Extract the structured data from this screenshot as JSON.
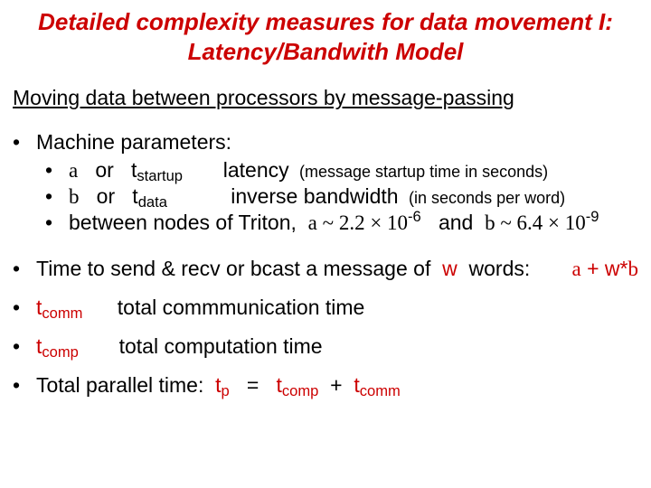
{
  "title_line1": "Detailed complexity measures for data movement I:",
  "title_line2": "Latency/Bandwith Model",
  "subheading": "Moving data between processors by message-passing",
  "params_label": "Machine parameters:",
  "alpha_line": {
    "sym": "a",
    "or": "or",
    "tvar": "t",
    "tsub": "startup",
    "label": "latency",
    "paren": "(message startup time in seconds)"
  },
  "beta_line": {
    "sym": "b",
    "or": "or",
    "tvar": "t",
    "tsub": "data",
    "label": "inverse bandwidth",
    "paren": "(in seconds per word)"
  },
  "triton": {
    "prefix": "between nodes of Triton,",
    "alpha_part": "a ~ 2.2 × 10",
    "alpha_exp": "-6",
    "and": "and",
    "beta_part": "b ~ 6.4 × 10",
    "beta_exp": "-9"
  },
  "send_recv": {
    "text": "Time to send & recv or bcast a message of",
    "w": "w",
    "words": "words:",
    "formula_a": "a",
    "formula_plus": " + w*",
    "formula_b": "b"
  },
  "tcomm": {
    "var": "t",
    "sub": "comm",
    "desc": "total commmunication time"
  },
  "tcomp": {
    "var": "t",
    "sub": "comp",
    "desc": "total computation time"
  },
  "total": {
    "label": "Total parallel time:",
    "tp_t": "t",
    "tp_sub": "p",
    "eq": "=",
    "t1_t": "t",
    "t1_sub": "comp",
    "plus": "+",
    "t2_t": "t",
    "t2_sub": "comm"
  }
}
